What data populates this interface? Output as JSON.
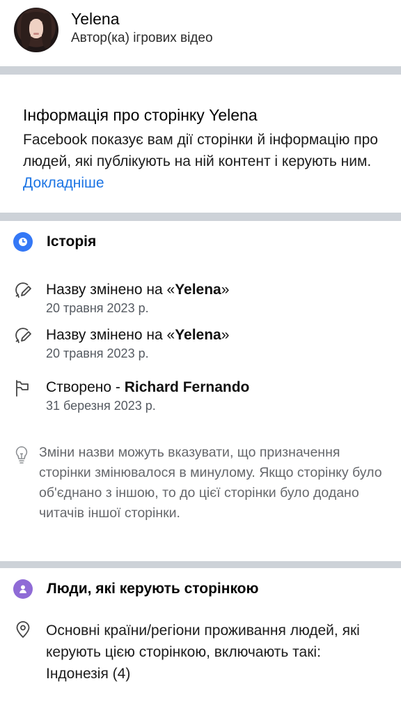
{
  "profile": {
    "name": "Yelena",
    "category": "Автор(ка) ігрових відео"
  },
  "info": {
    "title": "Інформація про сторінку Yelena",
    "description": "Facebook показує вам дії сторінки й інформацію про людей, які публікують на ній контент і керують ним.",
    "learn_more": "Докладніше"
  },
  "history": {
    "title": "Історія",
    "icon": "clock-icon",
    "events": [
      {
        "icon": "pencil-icon",
        "prefix": "Назву змінено на «",
        "name": "Yelena",
        "suffix": "»",
        "date": "20 травня 2023 р."
      },
      {
        "icon": "pencil-icon",
        "prefix": "Назву змінено на «",
        "name": "Yelena",
        "suffix": "»",
        "date": "20 травня 2023 р."
      },
      {
        "icon": "flag-icon",
        "prefix": "Створено - ",
        "name": "Richard Fernando",
        "suffix": "",
        "date": "31 березня 2023 р."
      }
    ],
    "tip_icon": "lightbulb-icon",
    "tip": "Зміни назви можуть вказувати, що призначення сторінки змінювалося в минулому. Якщо сторінку було об'єднано з іншою, то до цієї сторінки було додано читачів іншої сторінки."
  },
  "people": {
    "title": "Люди, які керують сторінкою",
    "icon": "person-icon",
    "location_icon": "location-pin-icon",
    "location_intro": "Основні країни/регіони проживання людей, які керують цією сторінкою, включають такі:",
    "location_value": "Індонезія (4)"
  },
  "colors": {
    "accent": "#1b74e4",
    "history_icon_bg": "#3478f6",
    "people_icon_bg": "#8f6bd6",
    "divider": "#cdd2d8"
  }
}
